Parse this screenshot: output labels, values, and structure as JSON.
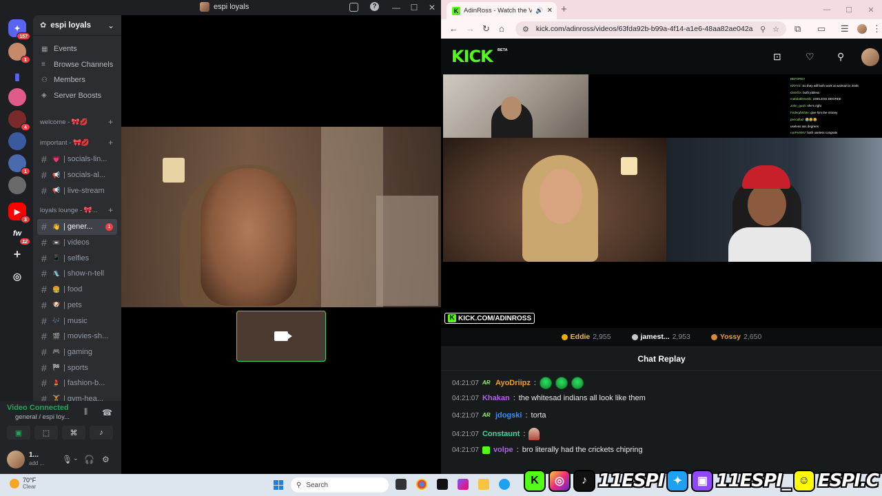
{
  "discord": {
    "window_title": "espi loyals",
    "win_controls": [
      "—",
      "☐",
      "✕"
    ],
    "servers": [
      {
        "name": "discord-home",
        "badge": "157",
        "color": "#5865f2"
      },
      {
        "name": "server-1",
        "badge": "1",
        "color": "#c48a6a"
      },
      {
        "name": "server-folder",
        "badge": "",
        "color": "#5865f2"
      },
      {
        "name": "server-3",
        "badge": "",
        "color": "#e05a8a"
      },
      {
        "name": "server-4",
        "badge": "4",
        "color": "#7a2a2a"
      },
      {
        "name": "server-5",
        "badge": "",
        "color": "#3a5aa0"
      },
      {
        "name": "server-6",
        "badge": "1",
        "color": "#4a6ab0"
      },
      {
        "name": "server-7",
        "badge": "",
        "color": "#6a6a6a"
      },
      {
        "name": "youtube-server",
        "badge": "3",
        "color": "#ff0000"
      },
      {
        "name": "fw-server",
        "badge": "12",
        "color": "#1e1f22",
        "label": "fw"
      }
    ],
    "server_name": "espi loyals",
    "nav": [
      {
        "label": "Events",
        "icon": "▦"
      },
      {
        "label": "Browse Channels",
        "icon": "≡"
      },
      {
        "label": "Members",
        "icon": "👤"
      },
      {
        "label": "Server Boosts",
        "icon": "◈"
      }
    ],
    "categories": {
      "welcome": "welcome - 🎀💋",
      "important": "important - 🎀💋",
      "loyals_lounge": "loyals lounge - 🎀..."
    },
    "channels_important": [
      {
        "emoji": "💗",
        "name": "| socials-lin..."
      },
      {
        "emoji": "📢",
        "name": "| socials-al..."
      },
      {
        "emoji": "📢",
        "name": "| live-stream"
      }
    ],
    "channels_lounge": [
      {
        "emoji": "👋",
        "name": "| gener...",
        "active": true,
        "unread": "1"
      },
      {
        "emoji": "📼",
        "name": "| videos"
      },
      {
        "emoji": "📱",
        "name": "| selfies"
      },
      {
        "emoji": "🛝",
        "name": "| show-n-tell"
      },
      {
        "emoji": "🍔",
        "name": "| food"
      },
      {
        "emoji": "🐶",
        "name": "| pets"
      },
      {
        "emoji": "🎶",
        "name": "| music"
      },
      {
        "emoji": "🎬",
        "name": "| movies-sh..."
      },
      {
        "emoji": "🎮",
        "name": "| gaming"
      },
      {
        "emoji": "🏁",
        "name": "| sports"
      },
      {
        "emoji": "💄",
        "name": "| fashion-b..."
      },
      {
        "emoji": "🏋️",
        "name": "| gym-hea..."
      }
    ],
    "voice": {
      "status": "Video Connected",
      "channel": "general / espi loy..."
    },
    "user": {
      "name": "1...",
      "sub": "add ..."
    }
  },
  "chrome": {
    "tab_title": "AdinRoss - Watch the VOD",
    "url": "kick.com/adinross/videos/63fda92b-b99a-4f14-a1e6-48aa82ae042a",
    "win_controls": [
      "—",
      "☐",
      "✕"
    ]
  },
  "kick": {
    "logo": "KICK",
    "beta": "BETA",
    "watermark": "KICK.COM/ADINROSS",
    "overlay_chat": [
      {
        "user": "BEFORE!!",
        "text": ""
      },
      {
        "user": "KRAYZ:",
        "text": "So they will both work at walmart in 2045"
      },
      {
        "user": "CEEGX:",
        "text": "both jobless"
      },
      {
        "user": "mattdatbrewski:",
        "text": "USELESS DEGREE"
      },
      {
        "user": "John_gush:",
        "text": "she's right"
      },
      {
        "user": "FederalWhite:",
        "text": "give him the money"
      },
      {
        "user": "pencaltaz:",
        "text": "😭😭😭"
      },
      {
        "user": "",
        "text": "useless ass degrees"
      },
      {
        "user": "ronPerkNV:",
        "text": "both useless congrats"
      }
    ],
    "leaderboard": [
      {
        "name": "Eddie",
        "count": "2,955",
        "color": "#e8c040",
        "medal": "gold"
      },
      {
        "name": "jamest...",
        "count": "2,953",
        "color": "#ffffff",
        "medal": "silver"
      },
      {
        "name": "Yossy",
        "count": "2,650",
        "color": "#f0a020",
        "medal": "bronze"
      }
    ],
    "chat_title": "Chat Replay",
    "messages": [
      {
        "time": "04:21:07",
        "badge": "AR",
        "user": "AyoDriipz",
        "color": "#f0a020",
        "text": "",
        "emotes": 3
      },
      {
        "time": "04:21:07",
        "badge": "",
        "user": "Khakan",
        "color": "#b05fe8",
        "text": "the whitesad indians all look like them",
        "emotes": 0
      },
      {
        "time": "04:21:07",
        "badge": "AR",
        "user": "jdogski",
        "color": "#3b8ff0",
        "text": "torta",
        "emotes": 0
      },
      {
        "time": "04:21:07",
        "badge": "",
        "user": "Constaunt",
        "color": "#3fd6a0",
        "text": "",
        "emotes": 0,
        "person_emote": true
      },
      {
        "time": "04:21:07",
        "badge": "green",
        "user": "volpe",
        "color": "#b05fe8",
        "text": "bro literally had the crickets chipring",
        "emotes": 0
      }
    ]
  },
  "taskbar": {
    "temp": "70°F",
    "condition": "Clear",
    "search": "Search"
  },
  "overlay": {
    "handle1": "11ESPI",
    "handle2": "11ESPI_",
    "handle3": "ESPI.C"
  }
}
